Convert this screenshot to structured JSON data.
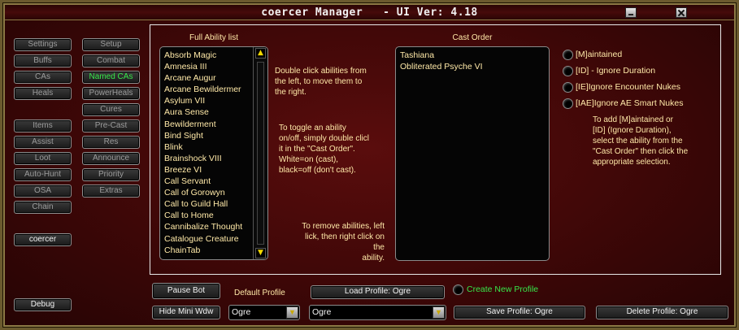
{
  "title": "coercer Manager   - UI Ver: 4.18",
  "colors": {
    "accent_active": "#37e64a",
    "text": "#ffe9a8",
    "bg": "#3d0707"
  },
  "left_col1": [
    "Settings",
    "Buffs",
    "CAs",
    "Heals",
    "Items",
    "Assist",
    "Loot",
    "Auto-Hunt",
    "OSA",
    "Chain"
  ],
  "left_col2": [
    "Setup",
    "Combat",
    "Named CAs",
    "PowerHeals",
    "Cures",
    "Pre-Cast",
    "Res",
    "Announce",
    "Priority",
    "Extras"
  ],
  "active_tab": "Named CAs",
  "character_button": "coercer",
  "debug_button": "Debug",
  "ability_list": {
    "label": "Full Ability list",
    "items": [
      "Absorb Magic",
      "Amnesia III",
      "Arcane Augur",
      "Arcane Bewildermer",
      "Asylum VII",
      "Aura Sense",
      "Bewilderment",
      "Bind Sight",
      "Blink",
      "Brainshock VIII",
      "Breeze VI",
      "Call Servant",
      "Call of Gorowyn",
      "Call to Guild Hall",
      "Call to Home",
      "Cannibalize Thought",
      "Catalogue Creature",
      "ChainTab"
    ]
  },
  "cast_order": {
    "label": "Cast Order",
    "items": [
      "Tashiana",
      "Obliterated Psyche VI"
    ]
  },
  "help": {
    "move": "Double click abilities from\nthe left, to move them to\nthe right.",
    "toggle": "To toggle an ability\non/off, simply double clicl\nit in the \"Cast Order\".\nWhite=on (cast),\nblack=off (don't cast).",
    "remove": "To remove abilities, left\nlick, then right click on the\nability.",
    "add_flags": "To add [M]aintained or\n[ID] (Ignore Duration),\nselect the ability from the\n\"Cast Order\" then click the\nappropriate selection."
  },
  "options": [
    "[M]aintained",
    "[ID] - Ignore Duration",
    "[IE]Ignore Encounter Nukes",
    "[IAE]Ignore AE Smart Nukes"
  ],
  "bottom": {
    "pause_bot": "Pause Bot",
    "hide_mini": "Hide Mini Wdw",
    "default_profile_label": "Default Profile",
    "default_profile_value": "Ogre",
    "load_profile": "Load Profile: Ogre",
    "profile_value": "Ogre",
    "create_new_profile": "Create New Profile",
    "save_profile": "Save Profile: Ogre",
    "delete_profile": "Delete Profile: Ogre"
  },
  "icons": {
    "scroll_up": "up-arrow-icon",
    "scroll_down": "down-arrow-icon",
    "dropdown": "chevron-down-icon"
  }
}
